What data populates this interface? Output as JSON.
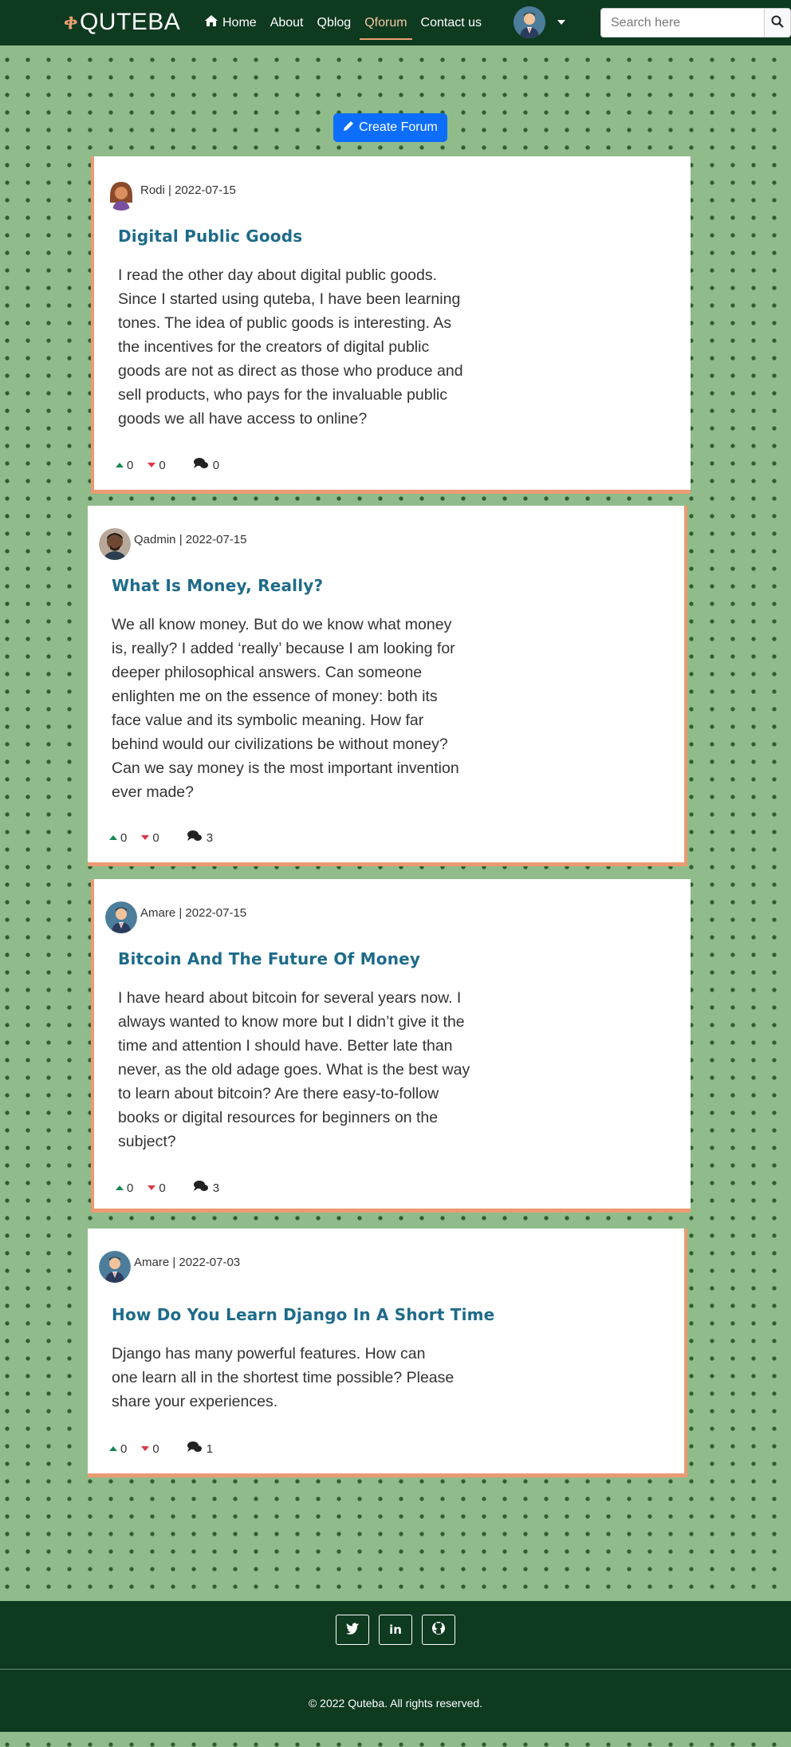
{
  "brand": {
    "mark": "ቀ",
    "name": "QUTEBA",
    "accent_color": "#e8a070"
  },
  "nav": {
    "links": [
      {
        "label": "Home",
        "icon": "home-icon"
      },
      {
        "label": "About"
      },
      {
        "label": "Qblog"
      },
      {
        "label": "Qforum",
        "active": true
      },
      {
        "label": "Contact us"
      }
    ],
    "search_placeholder": "Search here",
    "search_icon": "search-icon"
  },
  "create_button": {
    "label": "Create Forum",
    "icon": "pencil-icon",
    "color": "#0d6efd"
  },
  "posts": [
    {
      "author": "Rodi",
      "date": "2022-07-15",
      "title": "Digital Public Goods",
      "body": "I read the other day about digital public goods. Since I started using quteba, I have been learning tones. The idea of public goods is interesting. As the incentives for the creators of digital public goods are not as direct as those who produce and sell products, who pays for the invaluable public goods we all have access to online?",
      "upvotes": "0",
      "downvotes": "0",
      "comments": "0"
    },
    {
      "author": "Qadmin",
      "date": "2022-07-15",
      "title": "What Is Money, Really?",
      "body": "We all know money. But do we know what money is, really? I added ‘really’ because I am looking for deeper philosophical answers. Can someone enlighten me on the essence of money: both its face value and its symbolic meaning. How far behind would our civilizations be without money? Can we say money is the most important invention ever made?",
      "upvotes": "0",
      "downvotes": "0",
      "comments": "3"
    },
    {
      "author": "Amare",
      "date": "2022-07-15",
      "title": "Bitcoin And The Future Of Money",
      "body": "I have heard about bitcoin for several years now. I always wanted to know more but I didn’t give it the time and attention I should have. Better late than never, as the old adage goes. What is the best way to learn about bitcoin? Are there easy-to-follow books or digital resources for beginners on the subject?",
      "upvotes": "0",
      "downvotes": "0",
      "comments": "3"
    },
    {
      "author": "Amare",
      "date": "2022-07-03",
      "title": "How Do You Learn Django In A Short Time",
      "body": "Django has many powerful features. How can one learn all in the shortest time possible? Please share your experiences.",
      "upvotes": "0",
      "downvotes": "0",
      "comments": "1"
    }
  ],
  "footer": {
    "social": [
      "twitter-icon",
      "linkedin-icon",
      "github-icon"
    ],
    "copyright": "2022 Quteba. All rights reserved."
  }
}
